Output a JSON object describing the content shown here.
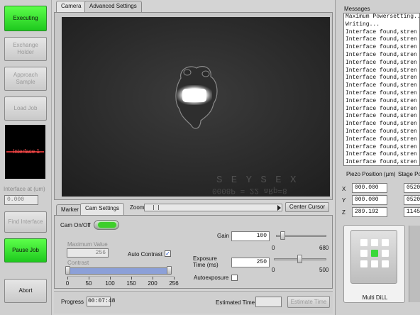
{
  "sidebar": {
    "executing": "Executing",
    "exchange_holder": "Exchange Holder",
    "approach_sample": "Approach Sample",
    "load_job": "Load Job",
    "preview_text": "Interface 1",
    "interface_at_label": "Interface at (um)",
    "interface_at_value": "0.000",
    "find_interface": "Find Interface",
    "pause_job": "Pause Job",
    "abort": "Abort"
  },
  "tabs": [
    "Camera",
    "Advanced Settings"
  ],
  "camera": {
    "watermark_line1": "S E Y S E X",
    "watermark_line2": "0008P = 22 aRp=8"
  },
  "subtabs": [
    "Marker",
    "Cam Settings"
  ],
  "zoom": {
    "label": "Zoom",
    "center_cursor": "Center Cursor"
  },
  "cam_settings": {
    "cam_onoff": "Cam On/Off",
    "max_value_label": "Maximum Value",
    "max_value": "256",
    "auto_contrast": "Auto Contrast",
    "contrast_label": "Contrast",
    "contrast_ticks": [
      "0",
      "50",
      "100",
      "150",
      "200",
      "256"
    ],
    "gain_label": "Gain",
    "gain_value": "100",
    "gain_min": "0",
    "gain_max": "680",
    "gain_level": 0.147,
    "exposure_label": "Exposure Time (ms)",
    "exposure_value": "250",
    "exposure_min": "0",
    "exposure_max": "500",
    "exposure_level": 0.5,
    "autoexposure": "Autoexposure"
  },
  "footer": {
    "progress_label": "Progress",
    "progress_value": "00:07:48",
    "estimated_label": "Estimated Time",
    "estimated_value": "",
    "estimate_button": "Estimate Time"
  },
  "messages": {
    "title": "Messages",
    "lines": [
      "Maximum Powersetting...",
      "Writing...",
      "Interface found,stren",
      "Interface found,stren",
      "Interface found,stren",
      "Interface found,stren",
      "Interface found,stren",
      "Interface found,stren",
      "Interface found,stren",
      "Interface found,stren",
      "Interface found,stren",
      "Interface found,stren",
      "Interface found,stren",
      "Interface found,stren",
      "Interface found,stren",
      "Interface found,stren",
      "Interface found,stren",
      "Interface found,stren",
      "Interface found,stren",
      "Interface found,stren",
      "Interface found,stren"
    ]
  },
  "piezo": {
    "title": "Piezo Position (µm)",
    "x_label": "X",
    "x": "000.000",
    "y_label": "Y",
    "y": "000.000",
    "z_label": "Z",
    "z": "289.192"
  },
  "stage": {
    "title": "Stage Po",
    "x": "0520",
    "y": "0520",
    "z": "1145"
  },
  "device": {
    "label": "Multi DiLL"
  },
  "colors": {
    "green": "#2fe02a",
    "slider_fill": "#8ca0d8"
  }
}
